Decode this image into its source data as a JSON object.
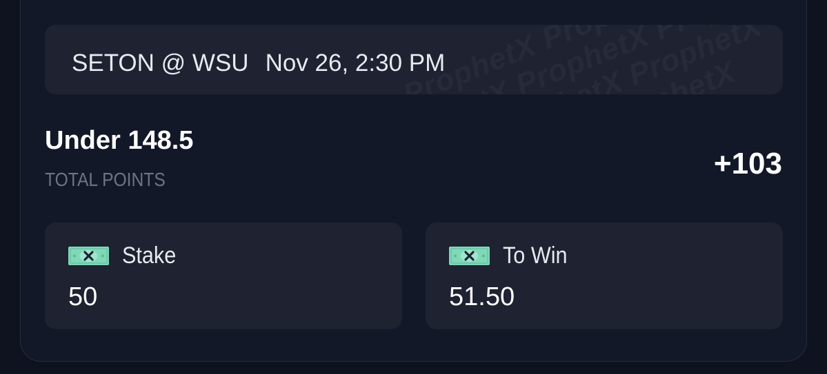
{
  "header": {
    "matchup": "SETON @ WSU",
    "datetime": "Nov 26, 2:30 PM",
    "watermark": "ProphetX"
  },
  "bet": {
    "selection": "Under 148.5",
    "market": "TOTAL POINTS",
    "odds": "+103"
  },
  "stake": {
    "label": "Stake",
    "value": "50",
    "icon": "cash-icon"
  },
  "to_win": {
    "label": "To Win",
    "value": "51.50",
    "icon": "cash-icon"
  },
  "colors": {
    "background": "#0f1320",
    "card": "#131828",
    "panel": "#1e2231",
    "cash_green": "#7fd8b8",
    "muted_text": "#6f7484"
  }
}
